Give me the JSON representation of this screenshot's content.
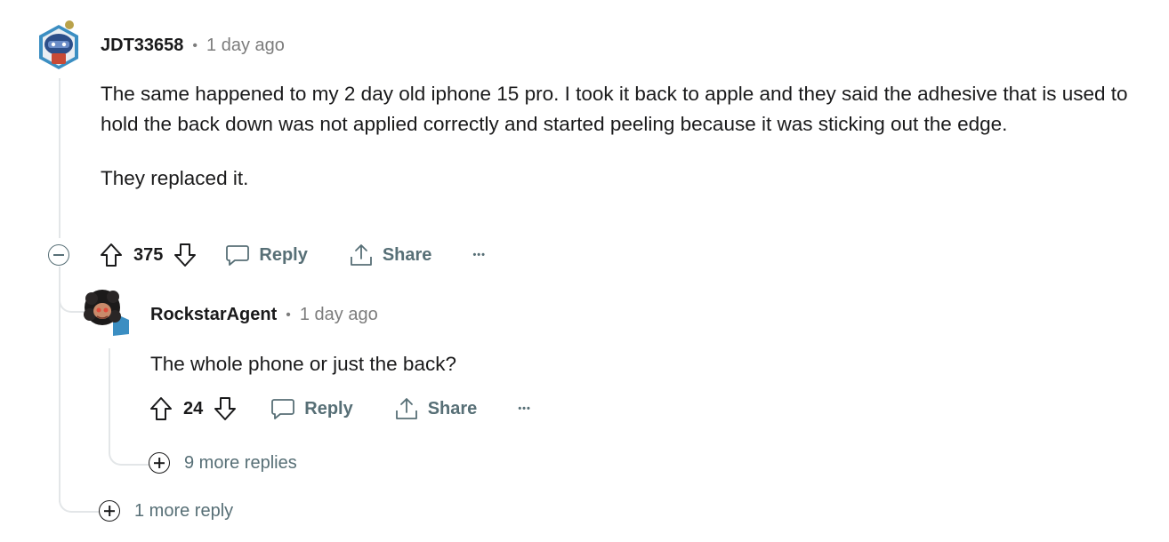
{
  "comment": {
    "author": "JDT33658",
    "separator": "•",
    "time": "1 day ago",
    "paragraphs": [
      "The same happened to my 2 day old iphone 15 pro. I took it back to apple and they said the adhesive that is used to hold the back down was not applied correctly and started peeling because it was sticking out the edge.",
      "They replaced it."
    ],
    "votes": "375",
    "reply_label": "Reply",
    "share_label": "Share",
    "more_label": "•••",
    "more_replies": "1 more reply"
  },
  "reply": {
    "author": "RockstarAgent",
    "separator": "•",
    "time": "1 day ago",
    "text": "The whole phone or just the back?",
    "votes": "24",
    "reply_label": "Reply",
    "share_label": "Share",
    "more_label": "•••",
    "more_replies": "9 more replies"
  },
  "icons": {
    "upvote": "arrow-up-outline",
    "downvote": "arrow-down-outline",
    "reply": "speech-bubble",
    "share": "share-upload",
    "collapse": "minus-circle",
    "expand": "plus-circle"
  },
  "colors": {
    "meta_gray": "#7c7c7c",
    "action_gray": "#576f76",
    "thread_line": "#e3e6e8",
    "text": "#1a1a1b"
  }
}
